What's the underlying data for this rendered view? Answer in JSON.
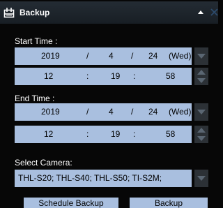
{
  "panel": {
    "title": "Backup",
    "icons": {
      "title": "backup-icon",
      "collapse": "collapse-up-icon",
      "close": "close-icon"
    }
  },
  "start_time": {
    "label": "Start Time :",
    "date": {
      "year": "2019",
      "sep1": "/",
      "month": "4",
      "sep2": "/",
      "day": "24",
      "weekday": "(Wed)"
    },
    "time": {
      "hour": "12",
      "sep1": ":",
      "minute": "19",
      "sep2": ":",
      "second": "58"
    }
  },
  "end_time": {
    "label": "End Time :",
    "date": {
      "year": "2019",
      "sep1": "/",
      "month": "4",
      "sep2": "/",
      "day": "24",
      "weekday": "(Wed)"
    },
    "time": {
      "hour": "12",
      "sep1": ":",
      "minute": "19",
      "sep2": ":",
      "second": "58"
    }
  },
  "camera": {
    "label": "Select Camera:",
    "value": "THL-S20; THL-S40; THL-S50; TI-S2M;"
  },
  "buttons": {
    "schedule_backup": "Schedule Backup",
    "backup": "Backup"
  },
  "colors": {
    "background": "#070707",
    "field": "#a9bfdf",
    "spin_button": "#2c3136",
    "text_light": "#ffffff"
  }
}
